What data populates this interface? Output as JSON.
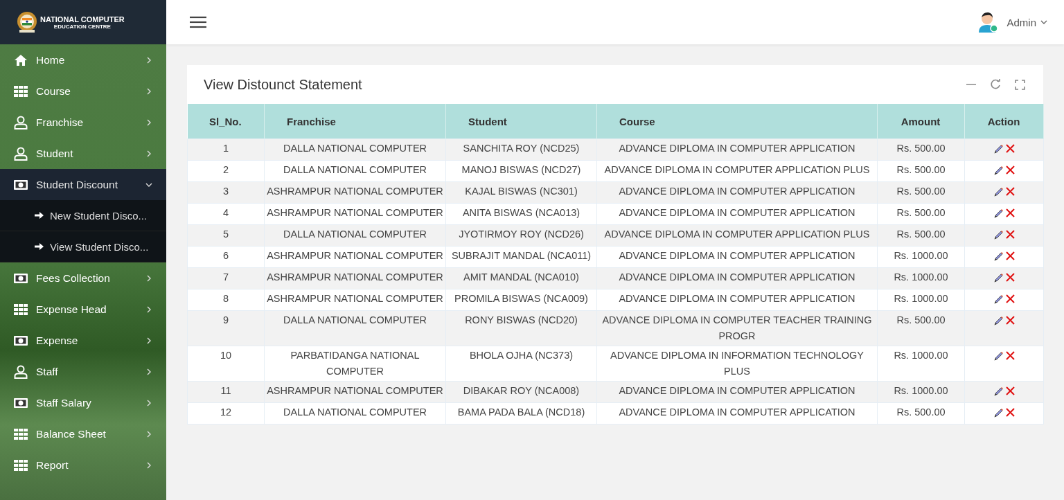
{
  "brand": {
    "line1": "NATIONAL COMPUTER",
    "line2": "EDUCATION CENTRE"
  },
  "sidebar": {
    "items": [
      {
        "label": "Home",
        "kind": "home",
        "expanded": false
      },
      {
        "label": "Course",
        "kind": "grid",
        "expanded": false
      },
      {
        "label": "Franchise",
        "kind": "user",
        "expanded": false
      },
      {
        "label": "Student",
        "kind": "user",
        "expanded": false
      },
      {
        "label": "Student Discount",
        "kind": "cash",
        "expanded": true,
        "children": [
          {
            "label": "New Student Disco..."
          },
          {
            "label": "View Student Disco..."
          }
        ]
      },
      {
        "label": "Fees Collection",
        "kind": "cash",
        "expanded": false
      },
      {
        "label": "Expense Head",
        "kind": "grid",
        "expanded": false
      },
      {
        "label": "Expense",
        "kind": "cash",
        "expanded": false
      },
      {
        "label": "Staff",
        "kind": "user",
        "expanded": false
      },
      {
        "label": "Staff Salary",
        "kind": "cash",
        "expanded": false
      },
      {
        "label": "Balance Sheet",
        "kind": "grid",
        "expanded": false
      },
      {
        "label": "Report",
        "kind": "grid",
        "expanded": false
      }
    ]
  },
  "topbar": {
    "user": "Admin"
  },
  "card": {
    "title": "View Distounct Statement"
  },
  "table": {
    "columns": [
      "Sl_No.",
      "Franchise",
      "Student",
      "Course",
      "Amount",
      "Action"
    ],
    "rows": [
      [
        "1",
        "DALLA NATIONAL COMPUTER",
        "SANCHITA ROY (NCD25)",
        "ADVANCE DIPLOMA IN COMPUTER APPLICATION",
        "Rs. 500.00"
      ],
      [
        "2",
        "DALLA NATIONAL COMPUTER",
        "MANOJ BISWAS (NCD27)",
        "ADVANCE DIPLOMA IN COMPUTER APPLICATION PLUS",
        "Rs. 500.00"
      ],
      [
        "3",
        "ASHRAMPUR NATIONAL COMPUTER",
        "KAJAL BISWAS (NC301)",
        "ADVANCE DIPLOMA IN COMPUTER APPLICATION",
        "Rs. 500.00"
      ],
      [
        "4",
        "ASHRAMPUR NATIONAL COMPUTER",
        "ANITA BISWAS (NCA013)",
        "ADVANCE DIPLOMA IN COMPUTER APPLICATION",
        "Rs. 500.00"
      ],
      [
        "5",
        "DALLA NATIONAL COMPUTER",
        "JYOTIRMOY ROY (NCD26)",
        "ADVANCE DIPLOMA IN COMPUTER APPLICATION PLUS",
        "Rs. 500.00"
      ],
      [
        "6",
        "ASHRAMPUR NATIONAL COMPUTER",
        "SUBRAJIT MANDAL (NCA011)",
        "ADVANCE DIPLOMA IN COMPUTER APPLICATION",
        "Rs. 1000.00"
      ],
      [
        "7",
        "ASHRAMPUR NATIONAL COMPUTER",
        "AMIT MANDAL (NCA010)",
        "ADVANCE DIPLOMA IN COMPUTER APPLICATION",
        "Rs. 1000.00"
      ],
      [
        "8",
        "ASHRAMPUR NATIONAL COMPUTER",
        "PROMILA BISWAS (NCA009)",
        "ADVANCE DIPLOMA IN COMPUTER APPLICATION",
        "Rs. 1000.00"
      ],
      [
        "9",
        "DALLA NATIONAL COMPUTER",
        "RONY BISWAS (NCD20)",
        "ADVANCE DIPLOMA IN COMPUTER TEACHER TRAINING PROGR",
        "Rs. 500.00"
      ],
      [
        "10",
        "PARBATIDANGA NATIONAL COMPUTER",
        "BHOLA OJHA (NC373)",
        "ADVANCE DIPLOMA IN INFORMATION TECHNOLOGY PLUS",
        "Rs. 1000.00"
      ],
      [
        "11",
        "ASHRAMPUR NATIONAL COMPUTER",
        "DIBAKAR ROY (NCA008)",
        "ADVANCE DIPLOMA IN COMPUTER APPLICATION",
        "Rs. 1000.00"
      ],
      [
        "12",
        "DALLA NATIONAL COMPUTER",
        "BAMA PADA BALA (NCD18)",
        "ADVANCE DIPLOMA IN COMPUTER APPLICATION",
        "Rs. 500.00"
      ]
    ]
  }
}
